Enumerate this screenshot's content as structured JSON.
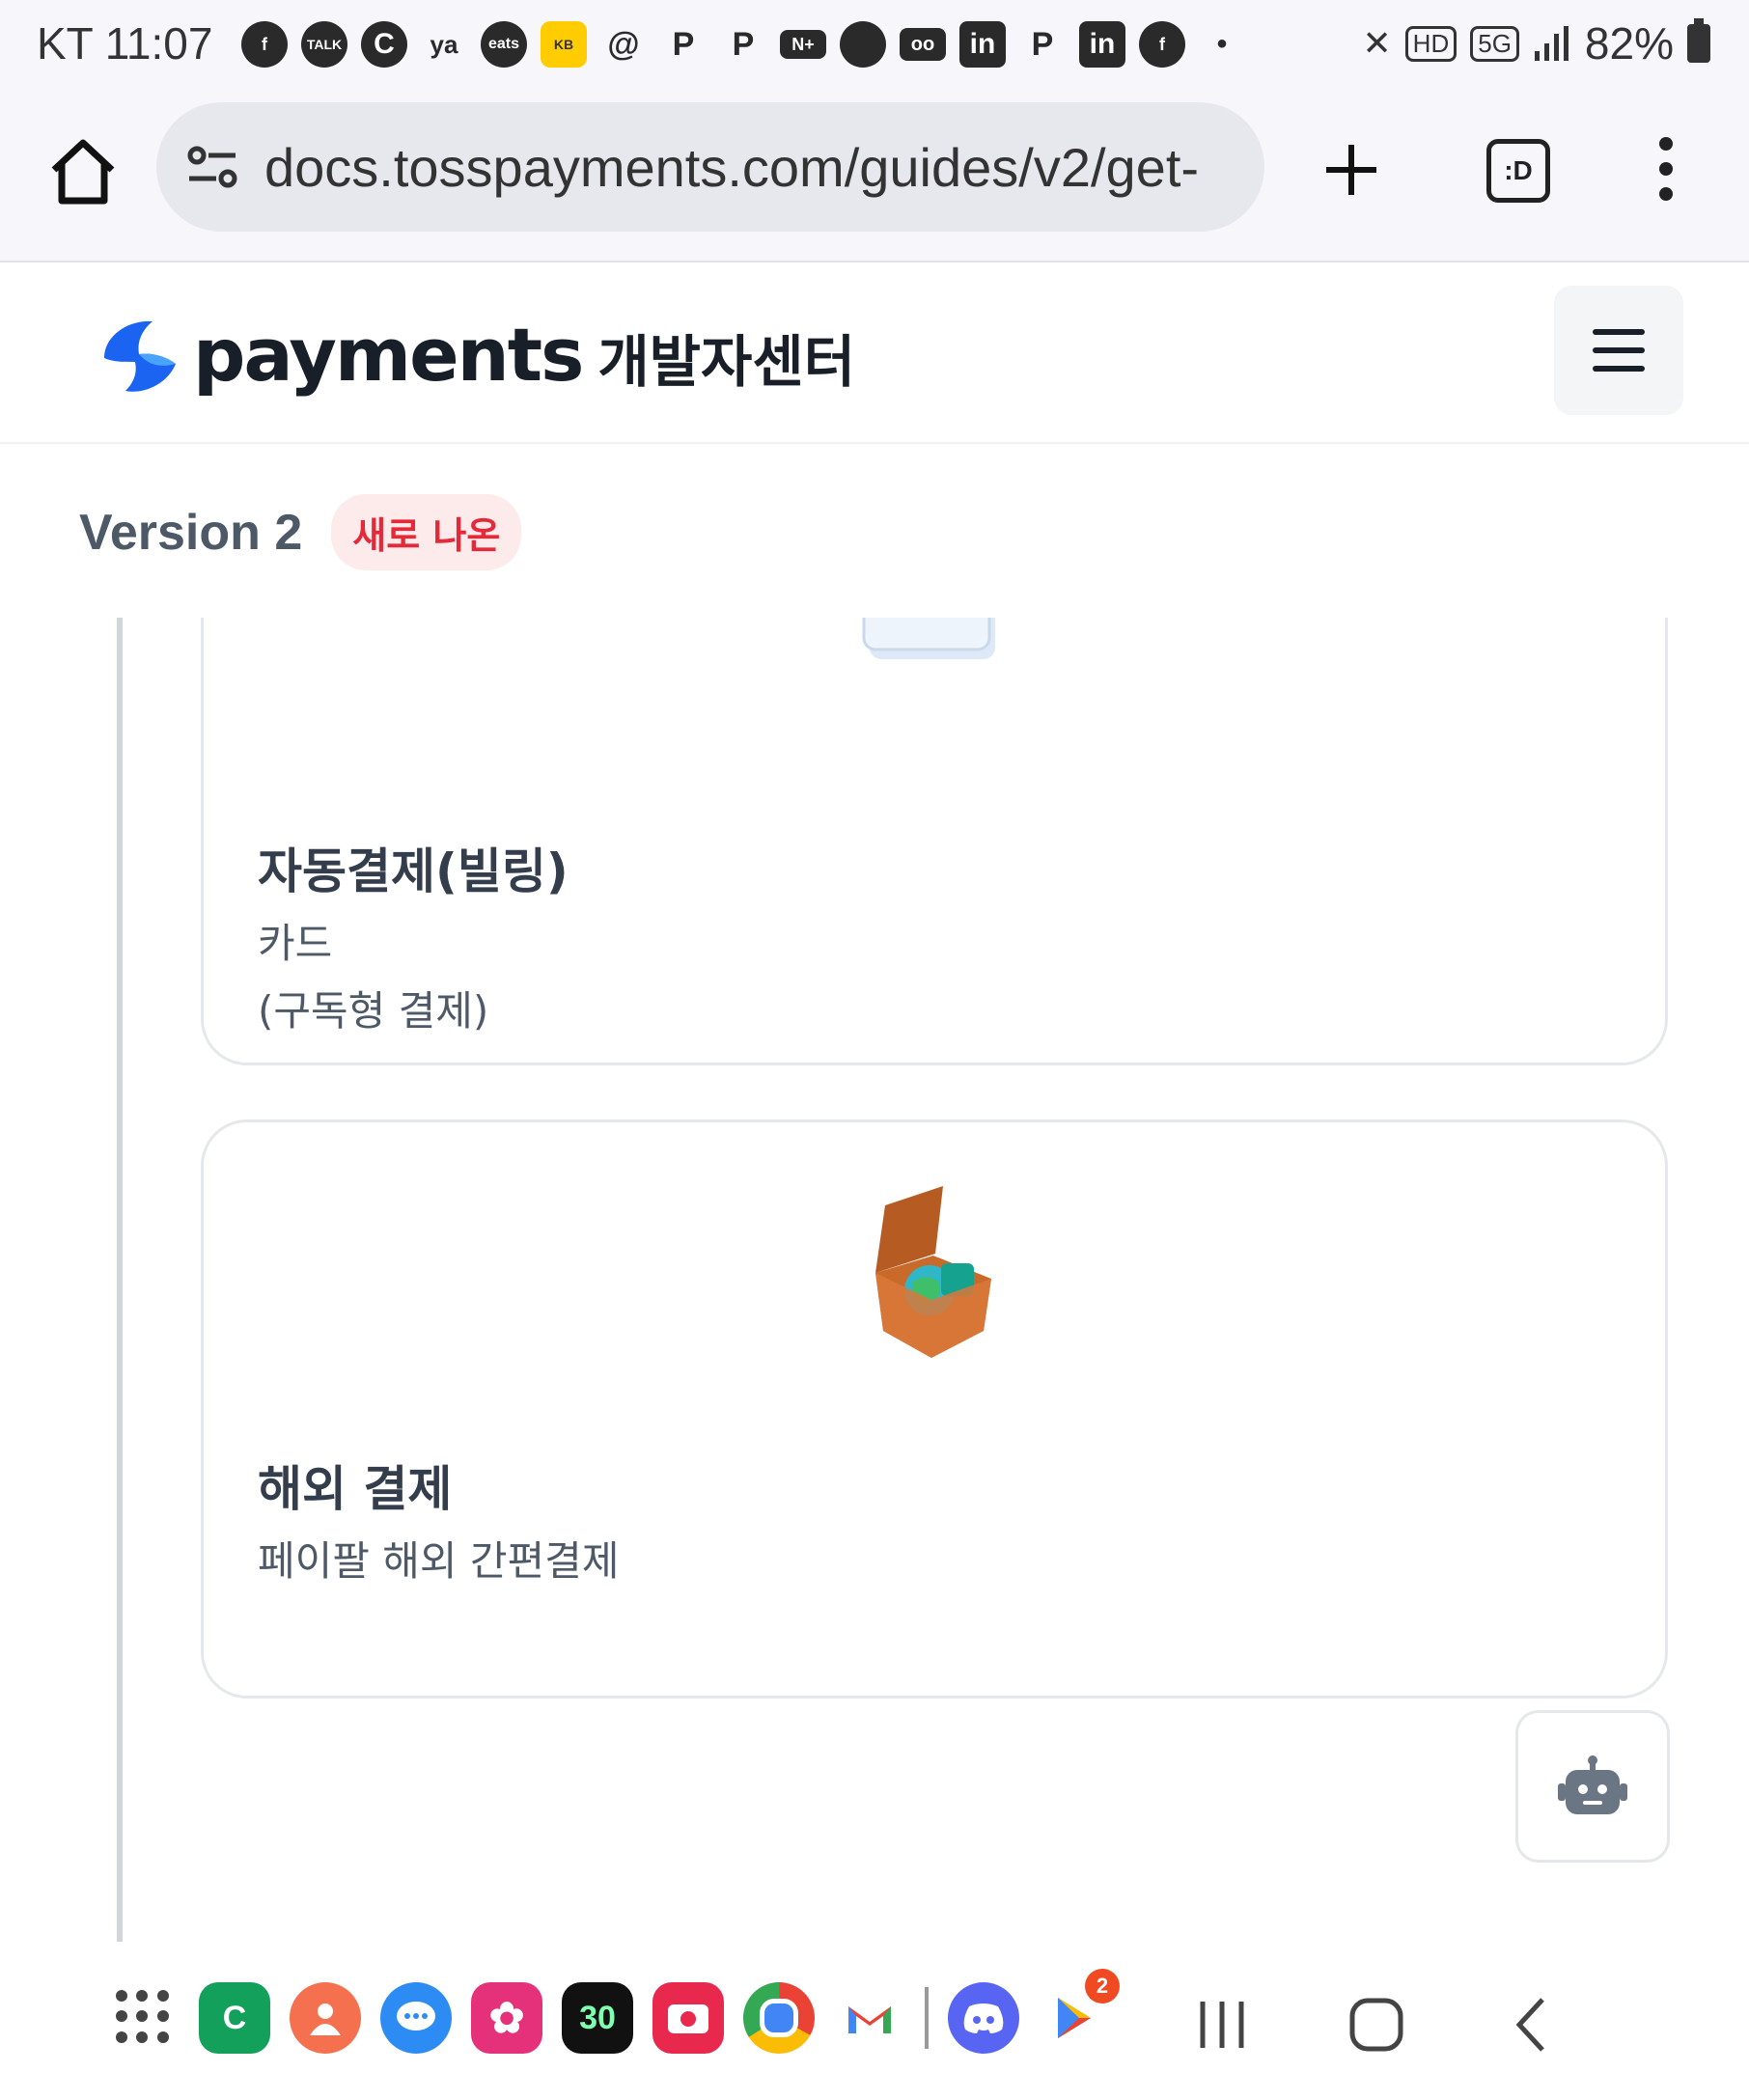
{
  "status_bar": {
    "carrier": "KT",
    "time": "11:07",
    "notification_icons": [
      "facebook-icon",
      "kakaotalk-icon",
      "c-app-icon",
      "yanolja-icon",
      "coupang-eats-icon",
      "kb-bank-icon",
      "threads-icon",
      "p-app-icon",
      "p-app-icon",
      "naver-plus-icon",
      "chat-bubble-icon",
      "voicemail-icon",
      "linkedin-icon",
      "p-app-icon",
      "linkedin-icon",
      "facebook-icon"
    ],
    "more_dot": "•",
    "hd_label": "HD",
    "network_label": "5G",
    "battery": "82%"
  },
  "browser": {
    "url": "docs.tosspayments.com/guides/v2/get-",
    "tabs_label": ":D"
  },
  "header": {
    "logo_word": "payments",
    "logo_sub": "개발자센터",
    "brand_color": "#0064ff"
  },
  "version": {
    "title": "Version 2",
    "badge": "새로 나온"
  },
  "cards": [
    {
      "title": "자동결제(빌링)",
      "desc_lines": [
        "카드",
        "(구독형 결제)"
      ],
      "image": "barcode-card-image"
    },
    {
      "title": "해외 결제",
      "desc_lines": [
        "페이팔 해외 간편결제"
      ],
      "image": "globe-box-image"
    }
  ],
  "nav": {
    "dock_apps": [
      "kakao-c-icon",
      "contacts-icon",
      "messages-icon",
      "flower-app-icon",
      "30-app-icon",
      "camera-app-icon",
      "chrome-icon",
      "gmail-icon",
      "discord-icon",
      "play-store-icon"
    ],
    "dock_labels": {
      "c": "C",
      "thirty": "30"
    },
    "play_badge": "2"
  }
}
